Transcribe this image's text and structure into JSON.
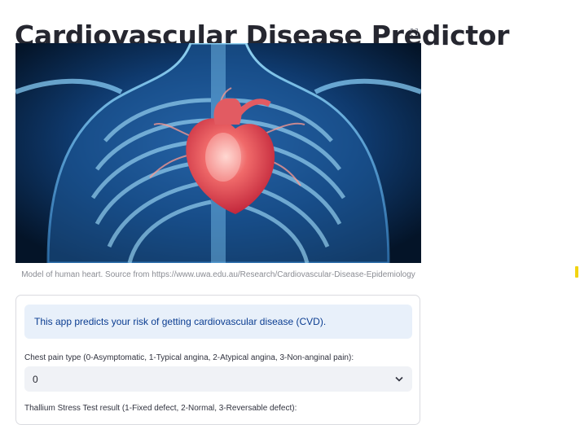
{
  "page": {
    "title": "Cardiovascular Disease Predictor"
  },
  "hero_image": {
    "caption": "Model of human heart. Source from https://www.uwa.edu.au/Research/Cardiovascular-Disease-Epidemiology",
    "fullscreen_icon": "expand-icon"
  },
  "form": {
    "info_text": "This app predicts your risk of getting cardiovascular disease (CVD).",
    "chest_pain": {
      "label": "Chest pain type (0-Asymptomatic, 1-Typical angina, 2-Atypical angina, 3-Non-anginal pain):",
      "value": "0",
      "icon": "chevron-down-icon"
    },
    "thallium": {
      "label": "Thallium Stress Test result (1-Fixed defect, 2-Normal, 3-Reversable defect):"
    }
  },
  "colors": {
    "info_bg": "#e8f0fa",
    "info_text": "#0b3d91",
    "select_bg": "#f0f2f6",
    "scroll_marker": "#f2d411"
  }
}
